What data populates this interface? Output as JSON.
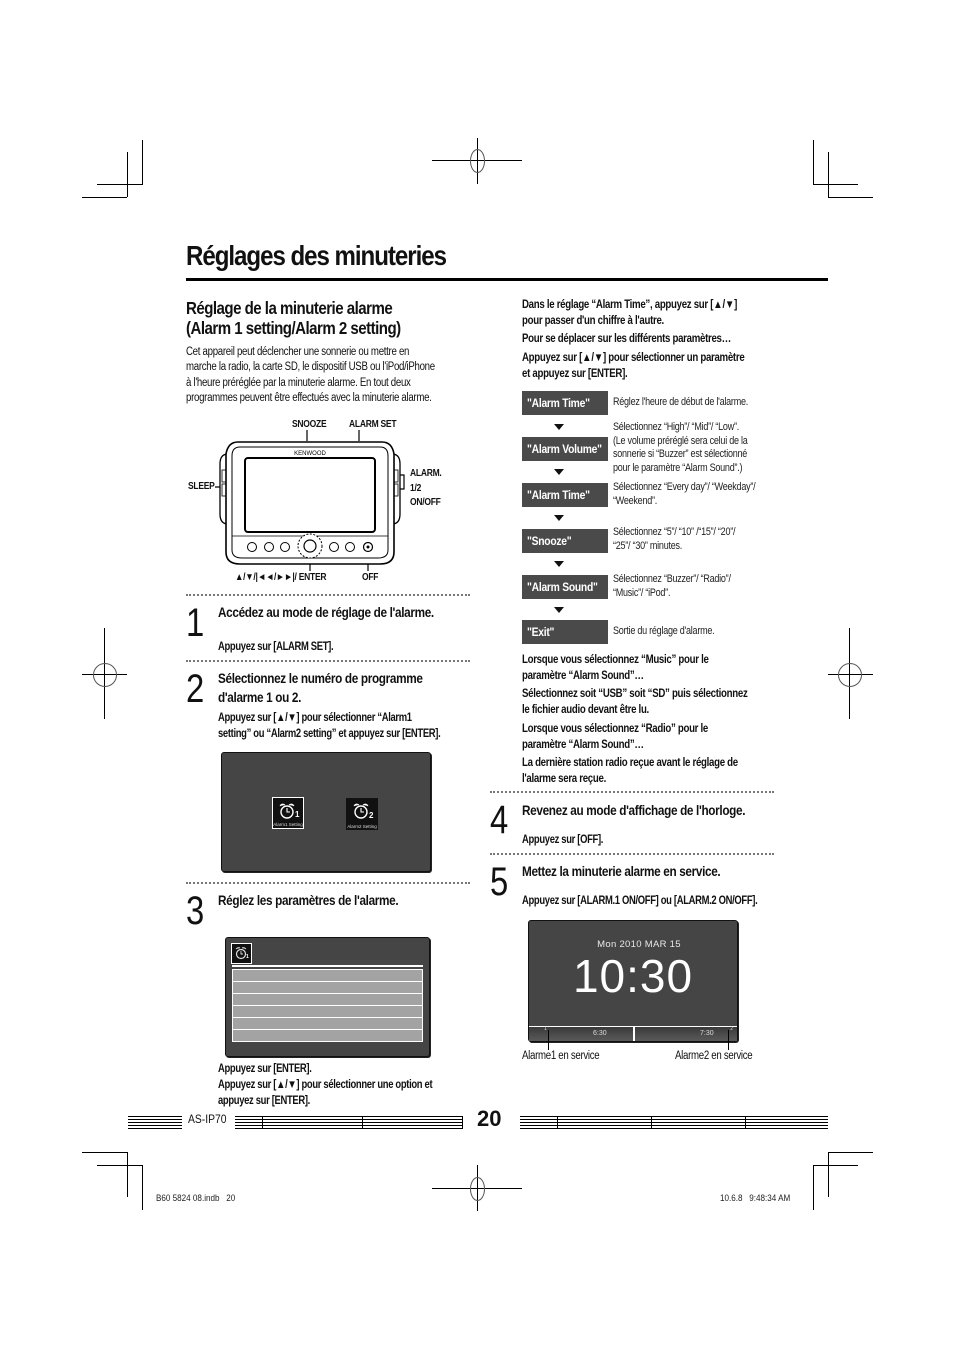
{
  "page": {
    "title": "Réglages des minuteries",
    "section_title_line1": "Réglage de la minuterie alarme",
    "section_title_line2": "(Alarm 1 setting/Alarm 2 setting)",
    "intro": [
      "Cet appareil peut déclencher une sonnerie ou mettre en",
      "marche la radio, la carte SD, le dispositif USB ou l'iPod/iPhone",
      "à l'heure préréglée par la minuterie alarme. En tout deux",
      "programmes peuvent être effectués avec la minuterie alarme."
    ]
  },
  "device": {
    "brand": "KENWOOD",
    "labels": {
      "snooze": "SNOOZE",
      "alarm_set": "ALARM SET",
      "sleep": "SLEEP",
      "alarm_line1": "ALARM.",
      "alarm_line2": "1/2",
      "alarm_line3": "ON/OFF",
      "nav": "▲/▼/|◄◄/►►|/ ENTER",
      "off": "OFF"
    }
  },
  "steps": [
    {
      "num": "1",
      "title": "Accédez au mode de réglage de l'alarme.",
      "lines": [
        "Appuyez sur [ALARM SET]."
      ]
    },
    {
      "num": "2",
      "title_line1": "Sélectionnez le numéro de programme",
      "title_line2": "d'alarme 1 ou 2.",
      "lines": [
        "Appuyez sur [▲/▼] pour sélectionner “Alarm1",
        "setting” ou “Alarm2 setting” et appuyez sur [ENTER]."
      ]
    },
    {
      "num": "3",
      "title": "Réglez les paramètres de l'alarme.",
      "lines": [
        "Appuyez sur [ENTER].",
        "Appuyez sur [▲/▼] pour sélectionner une option et",
        "appuyez sur [ENTER]."
      ]
    },
    {
      "num": "4",
      "title": "Revenez au mode d'affichage de l'horloge.",
      "lines": [
        "Appuyez sur [OFF]."
      ]
    },
    {
      "num": "5",
      "title": "Mettez la minuterie alarme en service.",
      "lines": [
        "Appuyez sur [ALARM.1 ON/OFF] ou [ALARM.2 ON/OFF]."
      ]
    }
  ],
  "alarm_select_screen": {
    "icons": [
      {
        "caption": "Alarm1 Setting",
        "num": "1",
        "selected": true
      },
      {
        "caption": "Alarm2 Setting",
        "num": "2",
        "selected": false
      }
    ]
  },
  "settings_screen": {
    "icon_num": "1",
    "row_count": 6
  },
  "right_intro": {
    "p1": [
      "Dans le réglage “Alarm Time”, appuyez sur [▲/▼]",
      "pour passer d'un chiffre à l'autre."
    ],
    "heading": "Pour se déplacer sur les différents paramètres…",
    "p2": [
      "Appuyez sur [▲/▼] pour sélectionner un paramètre",
      "et appuyez sur [ENTER]."
    ]
  },
  "flow": [
    {
      "label": "\"Alarm Time\"",
      "desc": [
        "Réglez l'heure de début de l'alarme."
      ]
    },
    {
      "label": "\"Alarm Volume\"",
      "desc": [
        "Sélectionnez “High”/ “Mid”/ “Low”.",
        "(Le volume préréglé sera celui de la",
        "sonnerie si “Buzzer” est sélectionné",
        "pour le paramètre “Alarm Sound”.)"
      ]
    },
    {
      "label": "\"Alarm Time\"",
      "desc": [
        "Sélectionnez “Every day”/ “Weekday”/",
        "“Weekend”."
      ]
    },
    {
      "label": "\"Snooze\"",
      "desc": [
        "Sélectionnez “5”/ “10” /“15”/ “20”/",
        "“25”/ “30” minutes."
      ]
    },
    {
      "label": "\"Alarm Sound\"",
      "desc": [
        "Sélectionnez “Buzzer”/ “Radio”/",
        "“Music”/ “iPod”."
      ]
    },
    {
      "label": "\"Exit\"",
      "desc": [
        "Sortie du réglage d'alarme."
      ]
    }
  ],
  "notes": {
    "music_heading": [
      "Lorsque vous sélectionnez “Music” pour le",
      "paramètre “Alarm Sound”…"
    ],
    "music_text": [
      "Sélectionnez soit “USB” soit “SD” puis sélectionnez",
      "le fichier audio devant être lu."
    ],
    "radio_heading": [
      "Lorsque vous sélectionnez “Radio” pour le",
      "paramètre “Alarm Sound”…"
    ],
    "radio_text": [
      "La dernière station radio reçue avant le réglage de",
      "l'alarme sera reçue."
    ]
  },
  "clock_screen": {
    "date": "Mon  2010  MAR  15",
    "time": "10:30",
    "alarm1_mark": "1",
    "alarm1_time": "6:30",
    "alarm2_mark": "2",
    "alarm2_time": "7:30",
    "caption_alarm1": "Alarme1 en service",
    "caption_alarm2": "Alarme2 en service"
  },
  "footer": {
    "model": "AS-IP70",
    "page_number": "20",
    "file_info": "B60 5824 08.indb   20",
    "timestamp": "10.6.8   9:48:34 AM"
  }
}
